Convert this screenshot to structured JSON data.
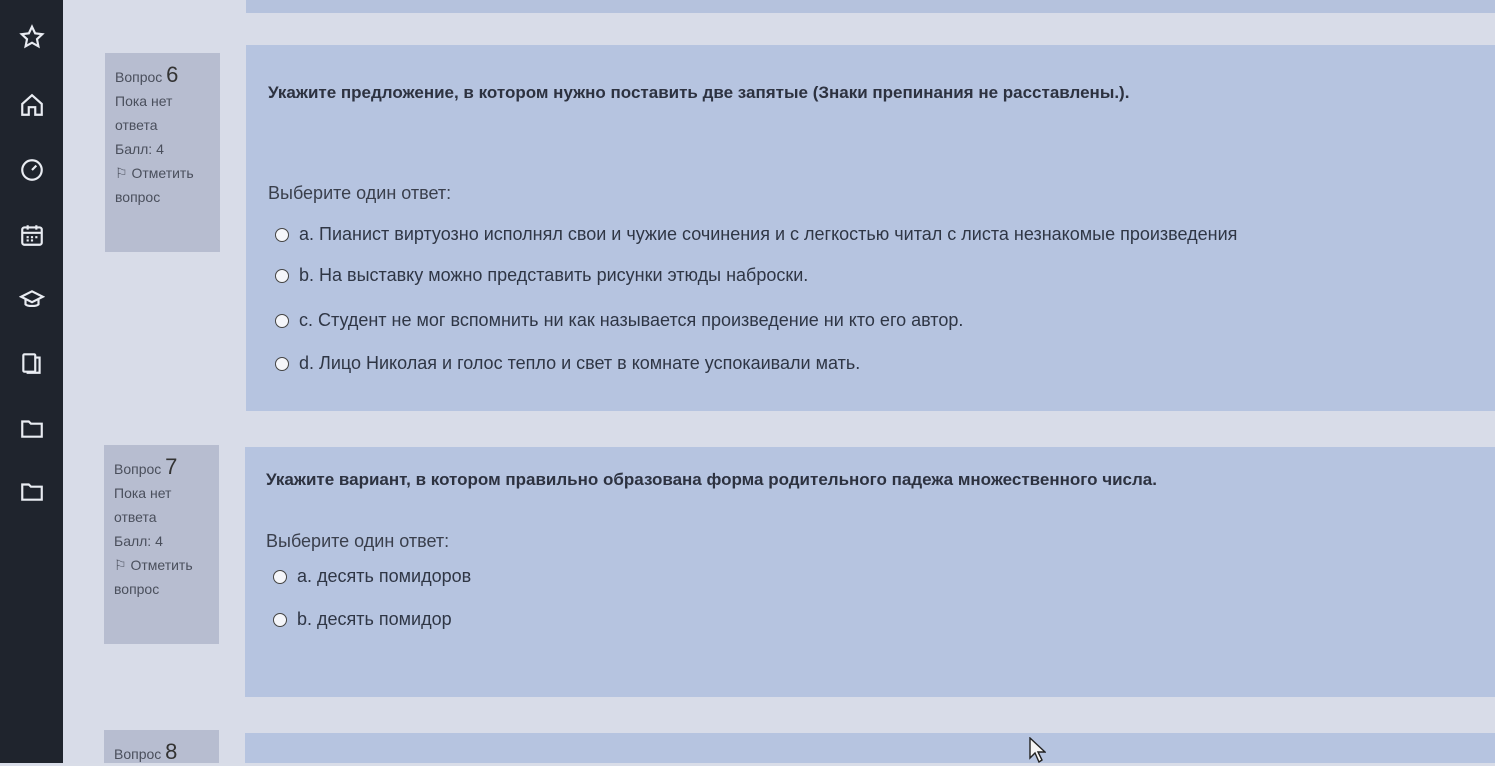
{
  "sidebar": {
    "icons": [
      "star-icon",
      "home-icon",
      "dashboard-icon",
      "calendar-icon",
      "graduation-cap-icon",
      "library-icon",
      "folder-icon",
      "folder-icon"
    ]
  },
  "questions": [
    {
      "label": "Вопрос",
      "number": "6",
      "status": "Пока нет ответа",
      "score": "Балл: 4",
      "flag": "Отметить вопрос",
      "text": "Укажите предложение, в котором нужно поставить две запятые (Знаки препинания не расставлены.).",
      "prompt": "Выберите один ответ:",
      "answers": [
        "a. Пианист виртуозно исполнял свои и чужие сочинения и с легкостью читал с листа незнакомые произведения",
        "b. На выставку можно представить рисунки этюды наброски.",
        "c. Студент не мог вспомнить ни как называется произведение ни кто его автор.",
        "d. Лицо Николая и голос тепло и свет в комнате успокаивали мать."
      ]
    },
    {
      "label": "Вопрос",
      "number": "7",
      "status": "Пока нет ответа",
      "score": "Балл: 4",
      "flag": "Отметить вопрос",
      "text": "Укажите вариант, в котором правильно образована форма родительного падежа множественного числа.",
      "prompt": "Выберите один ответ:",
      "answers": [
        "a. десять помидоров",
        "b. десять помидор"
      ]
    },
    {
      "label": "Вопрос",
      "number": "8"
    }
  ]
}
